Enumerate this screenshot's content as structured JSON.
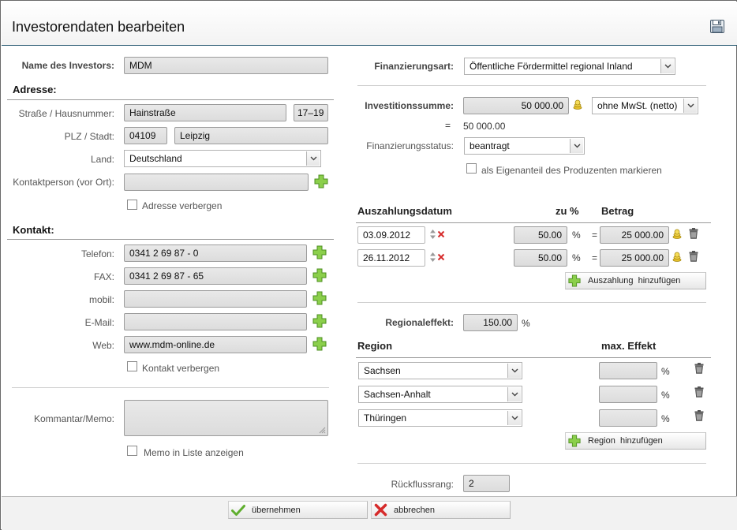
{
  "title": "Investorendaten bearbeiten",
  "left": {
    "investor_name_label": "Name des Investors:",
    "investor_name_value": "MDM",
    "address_section": "Adresse:",
    "street_label": "Straße / Hausnummer:",
    "street_value": "Hainstraße",
    "house_number_value": "17–19",
    "zip_city_label": "PLZ / Stadt:",
    "zip_value": "04109",
    "city_value": "Leipzig",
    "country_label": "Land:",
    "country_value": "Deutschland",
    "contact_person_label": "Kontaktperson (vor Ort):",
    "contact_person_value": "",
    "hide_address_label": "Adresse verbergen",
    "contact_section": "Kontakt:",
    "phone_label": "Telefon:",
    "phone_value": "0341 2 69 87 - 0",
    "fax_label": "FAX:",
    "fax_value": "0341 2 69 87 - 65",
    "mobile_label": "mobil:",
    "mobile_value": "",
    "email_label": "E-Mail:",
    "email_value": "",
    "web_label": "Web:",
    "web_value": "www.mdm-online.de",
    "hide_contact_label": "Kontakt verbergen",
    "comment_label": "Kommantar/Memo:",
    "comment_value": "",
    "memo_in_list_label": "Memo in Liste anzeigen"
  },
  "right": {
    "financing_type_label": "Finanzierungsart:",
    "financing_type_value": "Öffentliche Fördermittel regional Inland",
    "investment_sum_label": "Investitionssumme:",
    "investment_sum_value": "50 000.00",
    "vat_value": "ohne MwSt. (netto)",
    "equals": "=",
    "investment_net": "50 000.00",
    "financing_status_label": "Finanzierungsstatus:",
    "financing_status_value": "beantragt",
    "own_share_label": "als Eigenanteil des Produzenten markieren",
    "payout_headers": {
      "date": "Auszahlungsdatum",
      "percent": "zu %",
      "amount": "Betrag"
    },
    "payouts": [
      {
        "date": "03.09.2012",
        "percent": "50.00",
        "pct_sign": "%",
        "eq": "=",
        "amount": "25 000.00"
      },
      {
        "date": "26.11.2012",
        "percent": "50.00",
        "pct_sign": "%",
        "eq": "=",
        "amount": "25 000.00"
      }
    ],
    "add_payout_label": "Auszahlung  hinzufügen",
    "regional_effect_label": "Regionaleffekt:",
    "regional_effect_value": "150.00",
    "regional_effect_unit": "%",
    "region_headers": {
      "region": "Region",
      "max_effect": "max. Effekt"
    },
    "regions": [
      {
        "name": "Sachsen",
        "effect": "",
        "unit": "%"
      },
      {
        "name": "Sachsen-Anhalt",
        "effect": "",
        "unit": "%"
      },
      {
        "name": "Thüringen",
        "effect": "",
        "unit": "%"
      }
    ],
    "add_region_label": "Region  hinzufügen",
    "return_rank_label": "Rückflussrang:",
    "return_rank_value": "2"
  },
  "footer": {
    "apply_label": "übernehmen",
    "cancel_label": "abbrechen"
  },
  "colors": {
    "accent_line": "#2e5f76",
    "add_green": "#6cb33f",
    "cancel_red": "#d62b2b",
    "coin_yellow": "#e8c22c"
  }
}
